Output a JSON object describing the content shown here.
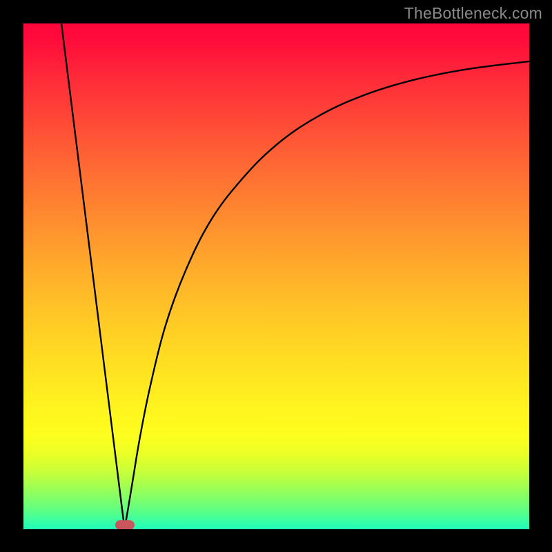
{
  "watermark": "TheBottleneck.com",
  "marker_color": "#c9555d",
  "chart_data": {
    "type": "line",
    "title": "",
    "xlabel": "",
    "ylabel": "",
    "xlim": [
      0,
      100
    ],
    "ylim": [
      0,
      100
    ],
    "x_special": 20,
    "curve_points": [
      {
        "x": 7.5,
        "y": 100
      },
      {
        "x": 9,
        "y": 88
      },
      {
        "x": 11,
        "y": 72
      },
      {
        "x": 13,
        "y": 56
      },
      {
        "x": 15,
        "y": 40
      },
      {
        "x": 17,
        "y": 24
      },
      {
        "x": 18.5,
        "y": 12
      },
      {
        "x": 19.5,
        "y": 4
      },
      {
        "x": 20,
        "y": 0.8
      },
      {
        "x": 20.5,
        "y": 3
      },
      {
        "x": 21.5,
        "y": 9
      },
      {
        "x": 23,
        "y": 18
      },
      {
        "x": 25,
        "y": 28
      },
      {
        "x": 28,
        "y": 40
      },
      {
        "x": 32,
        "y": 51
      },
      {
        "x": 37,
        "y": 61
      },
      {
        "x": 43,
        "y": 69
      },
      {
        "x": 50,
        "y": 76
      },
      {
        "x": 58,
        "y": 81.5
      },
      {
        "x": 67,
        "y": 85.7
      },
      {
        "x": 77,
        "y": 88.8
      },
      {
        "x": 88,
        "y": 91
      },
      {
        "x": 100,
        "y": 92.5
      }
    ],
    "marker": {
      "x": 20,
      "y": 0.8
    }
  }
}
